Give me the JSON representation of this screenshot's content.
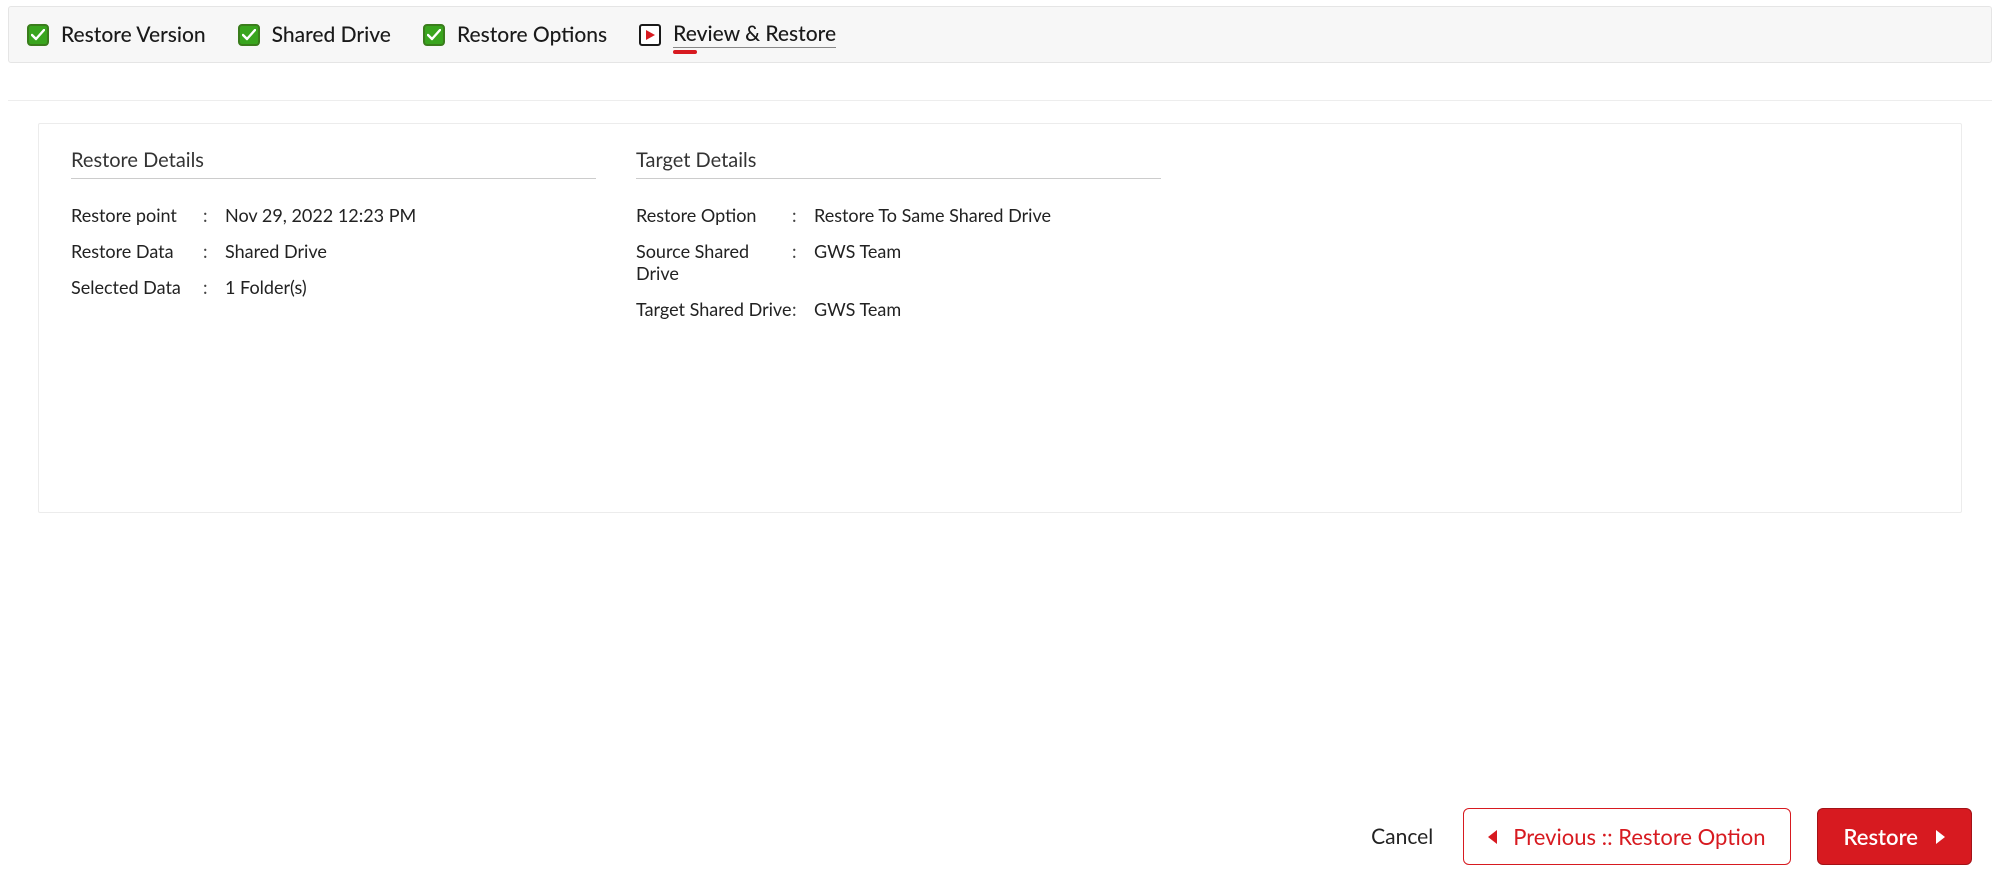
{
  "colors": {
    "accent_red": "#d71a20",
    "check_green": "#39a51e"
  },
  "stepper": {
    "steps": [
      {
        "label": "Restore Version",
        "state": "done"
      },
      {
        "label": "Shared Drive",
        "state": "done"
      },
      {
        "label": "Restore Options",
        "state": "done"
      },
      {
        "label": "Review & Restore",
        "state": "active"
      }
    ]
  },
  "restore_details": {
    "title": "Restore Details",
    "rows": [
      {
        "k": "Restore point",
        "v": "Nov 29, 2022 12:23 PM"
      },
      {
        "k": "Restore Data",
        "v": "Shared Drive"
      },
      {
        "k": "Selected Data",
        "v": "1 Folder(s)"
      }
    ]
  },
  "target_details": {
    "title": "Target Details",
    "rows": [
      {
        "k": "Restore Option",
        "v": "Restore To Same Shared Drive"
      },
      {
        "k": "Source Shared Drive",
        "v": "GWS Team"
      },
      {
        "k": "Target Shared Drive",
        "v": "GWS Team"
      }
    ]
  },
  "footer": {
    "cancel": "Cancel",
    "previous": "Previous :: Restore Option",
    "restore": "Restore"
  }
}
